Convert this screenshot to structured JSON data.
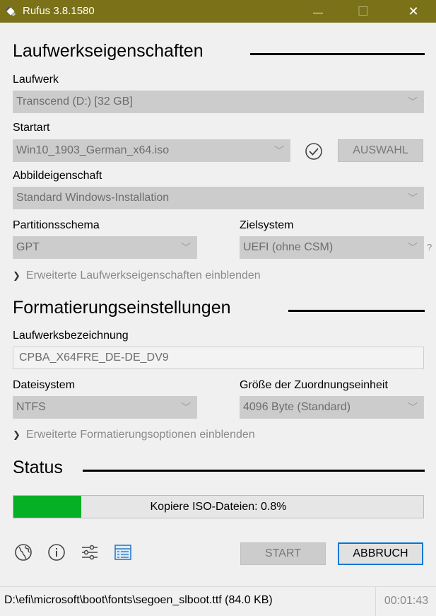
{
  "window": {
    "title": "Rufus 3.8.1580",
    "minimize": "—",
    "maximize": "☐",
    "close": "✕"
  },
  "drive_properties": {
    "heading": "Laufwerkseigenschaften",
    "drive_label": "Laufwerk",
    "drive_value": "Transcend (D:) [32 GB]",
    "boot_label": "Startart",
    "boot_value": "Win10_1903_German_x64.iso",
    "select_button": "AUSWAHL",
    "image_option_label": "Abbildeigenschaft",
    "image_option_value": "Standard Windows-Installation",
    "partition_label": "Partitionsschema",
    "partition_value": "GPT",
    "target_label": "Zielsystem",
    "target_value": "UEFI (ohne CSM)",
    "help_glyph": "?",
    "advanced_toggle": "Erweiterte Laufwerkseigenschaften einblenden"
  },
  "format_options": {
    "heading": "Formatierungseinstellungen",
    "volume_label_label": "Laufwerksbezeichnung",
    "volume_label_value": "CPBA_X64FRE_DE-DE_DV9",
    "filesystem_label": "Dateisystem",
    "filesystem_value": "NTFS",
    "cluster_label": "Größe der Zuordnungseinheit",
    "cluster_value": "4096 Byte (Standard)",
    "advanced_toggle": "Erweiterte Formatierungsoptionen einblenden"
  },
  "status": {
    "heading": "Status",
    "progress_text": "Kopiere ISO-Dateien: 0.8%",
    "progress_fraction": 0.165
  },
  "actions": {
    "start": "START",
    "cancel": "ABBRUCH"
  },
  "statusbar": {
    "path": "D:\\efi\\microsoft\\boot\\fonts\\segoen_slboot.ttf (84.0 KB)",
    "elapsed": "00:01:43"
  },
  "colors": {
    "titlebar": "#7a7118",
    "progress_fill": "#06b025",
    "accent": "#0078d7"
  },
  "icons": [
    "usb-drive-icon",
    "chevron-down-icon",
    "check-circle-icon",
    "globe-icon",
    "info-icon",
    "settings-sliders-icon",
    "log-icon"
  ]
}
